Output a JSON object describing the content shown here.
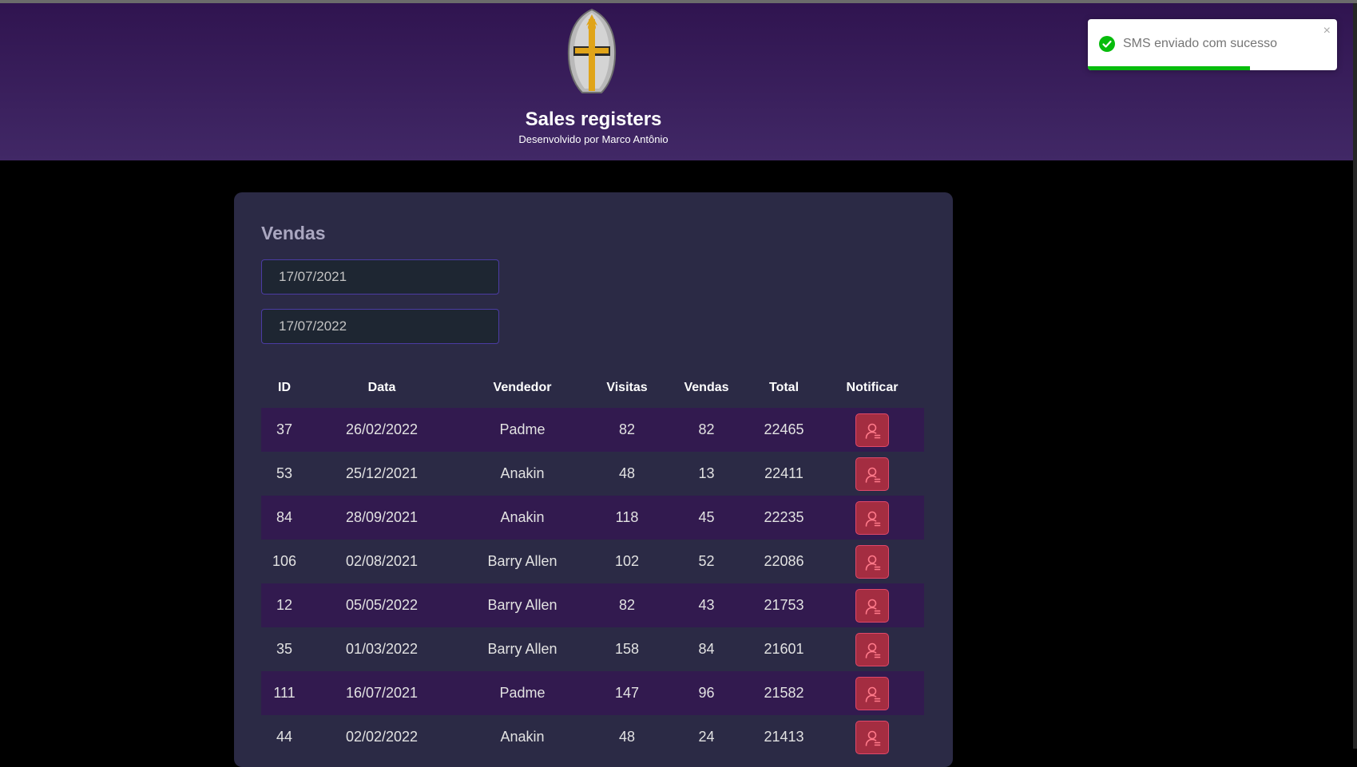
{
  "header": {
    "title": "Sales registers",
    "subtitle": "Desenvolvido por Marco Antônio",
    "logo_icon": "knight-helmet-icon"
  },
  "toast": {
    "message": "SMS enviado com sucesso",
    "icon": "check-circle-icon",
    "close_label": "×",
    "progress": 0.65,
    "color": "#07bc0c"
  },
  "card": {
    "title": "Vendas",
    "min_date": "17/07/2021",
    "max_date": "17/07/2022"
  },
  "table": {
    "headers": {
      "id": "ID",
      "date": "Data",
      "seller": "Vendedor",
      "visits": "Visitas",
      "sales": "Vendas",
      "total": "Total",
      "notify": "Notificar"
    },
    "rows": [
      {
        "id": "37",
        "date": "26/02/2022",
        "seller": "Padme",
        "visits": "82",
        "sales": "82",
        "total": "22465"
      },
      {
        "id": "53",
        "date": "25/12/2021",
        "seller": "Anakin",
        "visits": "48",
        "sales": "13",
        "total": "22411"
      },
      {
        "id": "84",
        "date": "28/09/2021",
        "seller": "Anakin",
        "visits": "118",
        "sales": "45",
        "total": "22235"
      },
      {
        "id": "106",
        "date": "02/08/2021",
        "seller": "Barry Allen",
        "visits": "102",
        "sales": "52",
        "total": "22086"
      },
      {
        "id": "12",
        "date": "05/05/2022",
        "seller": "Barry Allen",
        "visits": "82",
        "sales": "43",
        "total": "21753"
      },
      {
        "id": "35",
        "date": "01/03/2022",
        "seller": "Barry Allen",
        "visits": "158",
        "sales": "84",
        "total": "21601"
      },
      {
        "id": "111",
        "date": "16/07/2021",
        "seller": "Padme",
        "visits": "147",
        "sales": "96",
        "total": "21582"
      },
      {
        "id": "44",
        "date": "02/02/2022",
        "seller": "Anakin",
        "visits": "48",
        "sales": "24",
        "total": "21413"
      }
    ],
    "notify_icon": "user-notify-icon"
  },
  "colors": {
    "header_top": "#301450",
    "header_bottom": "#412866",
    "card_bg": "#2b2a45",
    "odd_row": "#321a4f",
    "notify_border": "#e0486a"
  }
}
